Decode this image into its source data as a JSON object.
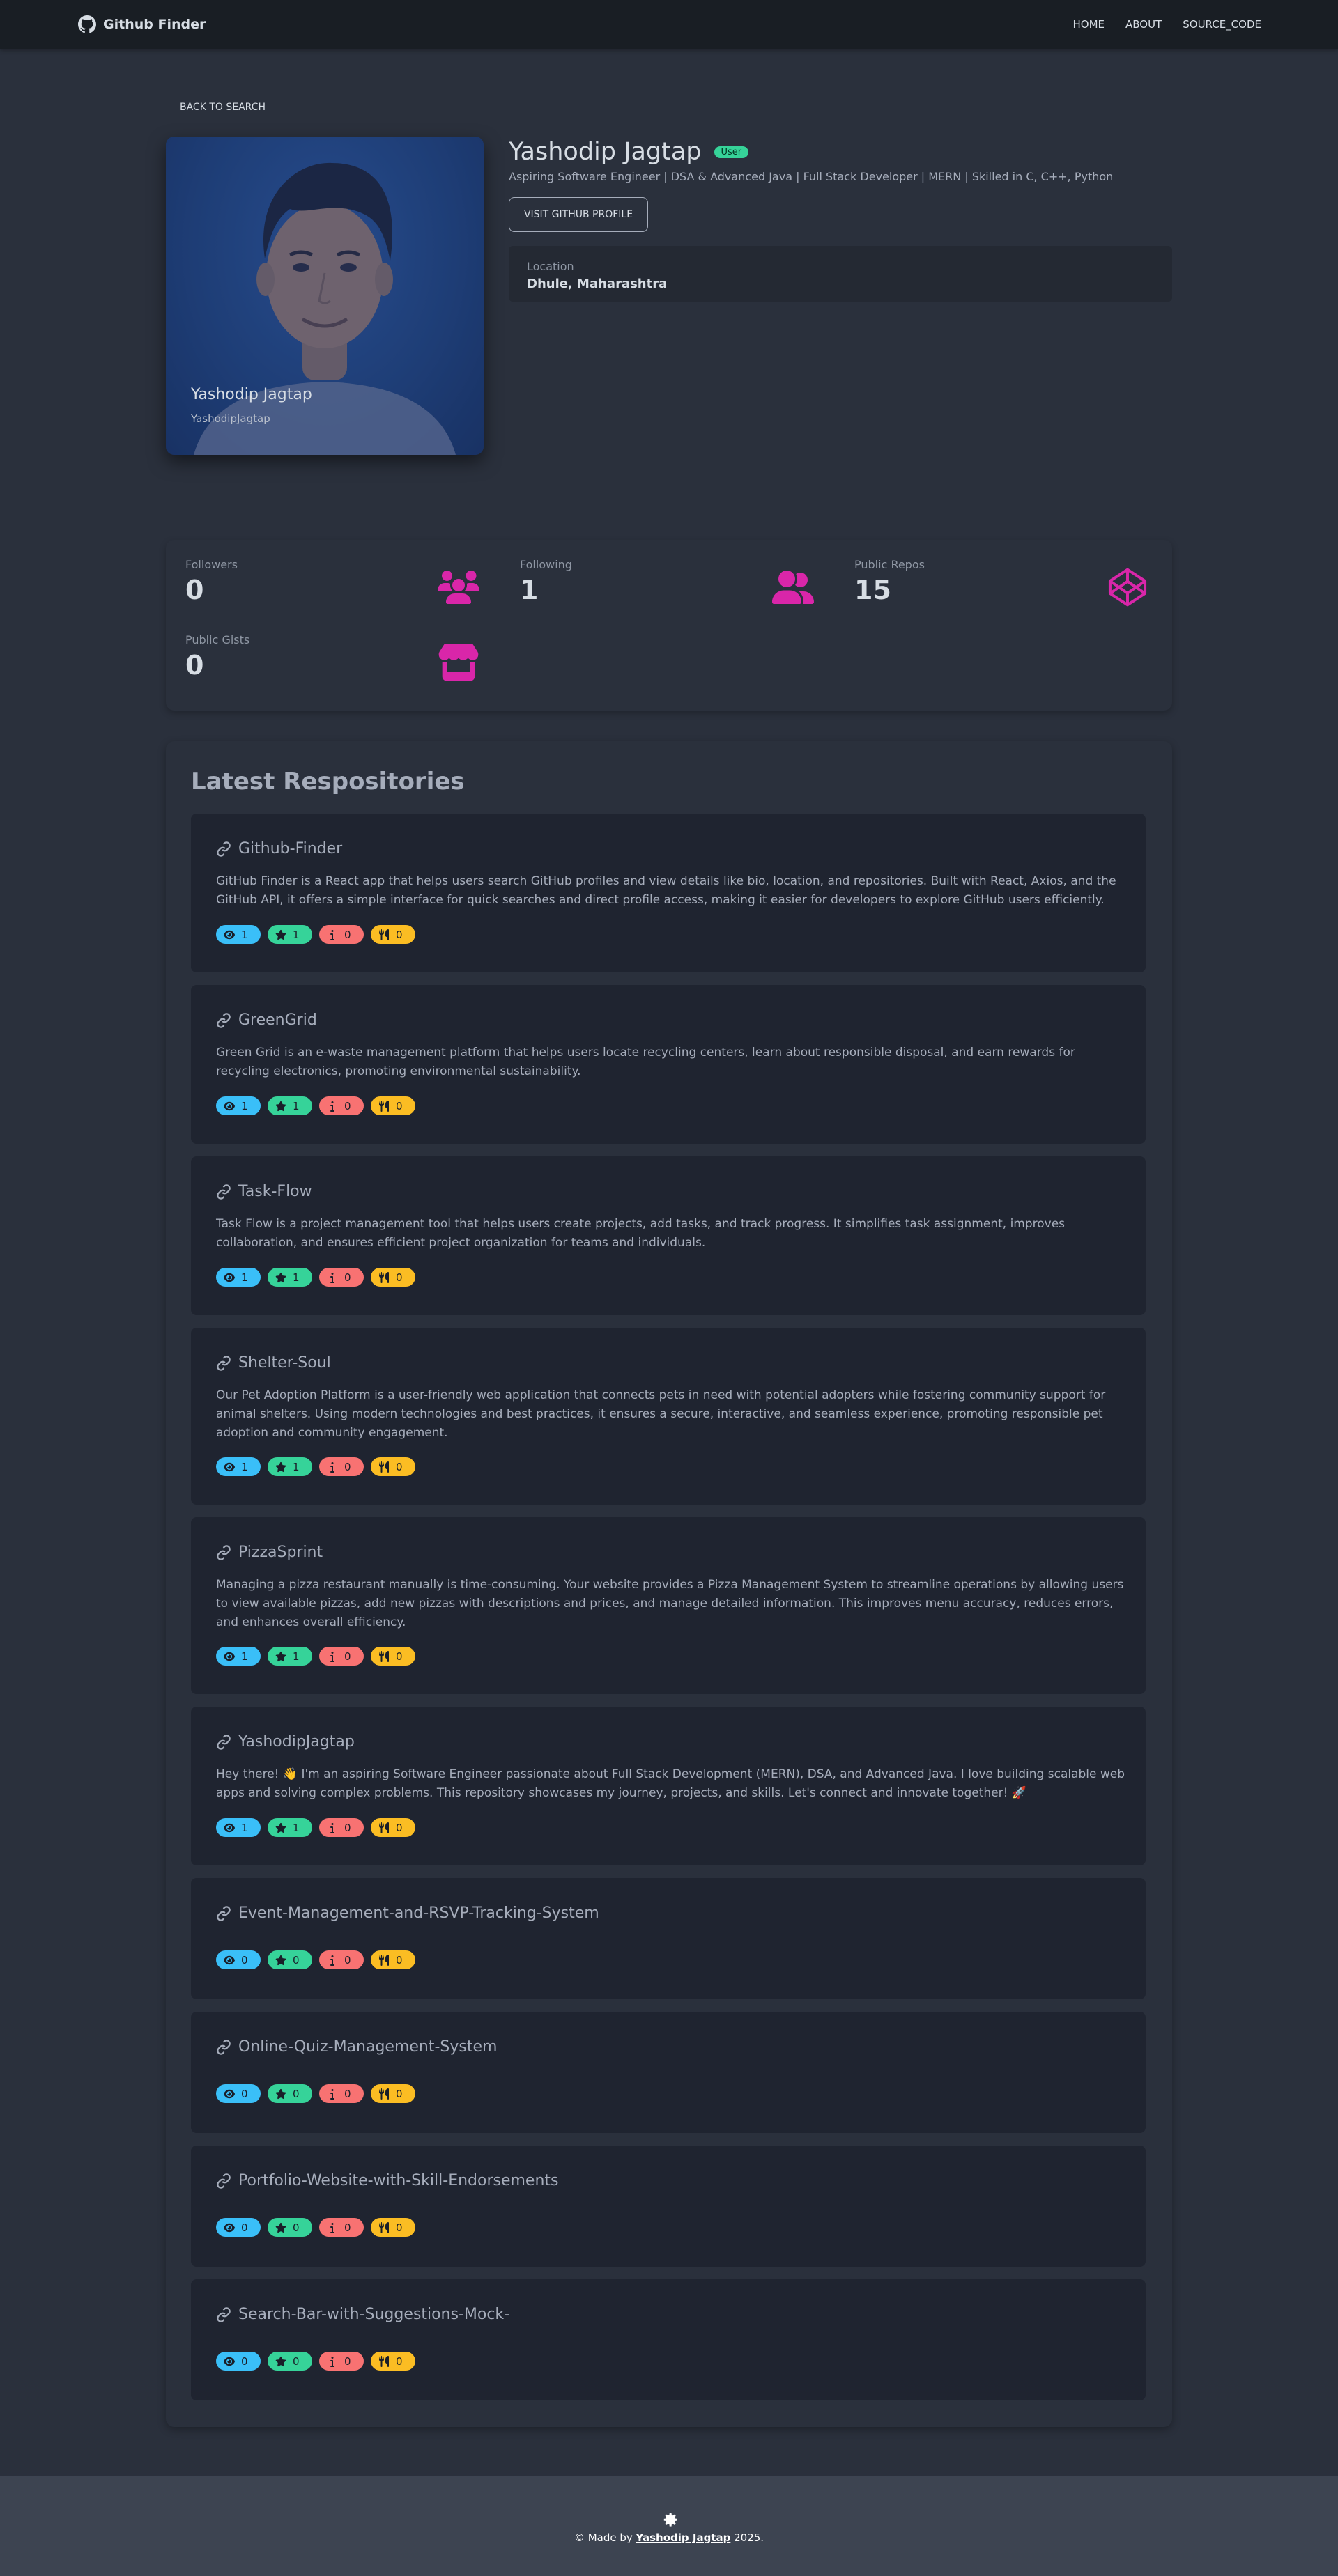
{
  "navbar": {
    "brand": "Github Finder",
    "links": [
      "HOME",
      "ABOUT",
      "SOURCE_CODE"
    ]
  },
  "back_label": "BACK TO SEARCH",
  "profile": {
    "avatar_name": "Yashodip Jagtap",
    "avatar_login": "YashodipJagtap",
    "name": "Yashodip Jagtap",
    "type_badge": "User",
    "bio": "Aspiring Software Engineer | DSA & Advanced Java | Full Stack Developer | MERN | Skilled in C, C++, Python",
    "visit_label": "VISIT GITHUB PROFILE",
    "location_label": "Location",
    "location_value": "Dhule, Maharashtra"
  },
  "stats": [
    {
      "title": "Followers",
      "value": "0",
      "icon": "users-group-icon"
    },
    {
      "title": "Following",
      "value": "1",
      "icon": "user-friends-icon"
    },
    {
      "title": "Public Repos",
      "value": "15",
      "icon": "codepen-icon"
    },
    {
      "title": "Public Gists",
      "value": "0",
      "icon": "store-icon"
    }
  ],
  "repos_title": "Latest Respositories",
  "repos": [
    {
      "name": "Github-Finder",
      "desc": "GitHub Finder is a React app that helps users search GitHub profiles and view details like bio, location, and repositories. Built with React, Axios, and the GitHub API, it offers a simple interface for quick searches and direct profile access, making it easier for developers to explore GitHub users efficiently.",
      "watchers": "1",
      "stars": "1",
      "issues": "0",
      "forks": "0"
    },
    {
      "name": "GreenGrid",
      "desc": "Green Grid is an e-waste management platform that helps users locate recycling centers, learn about responsible disposal, and earn rewards for recycling electronics, promoting environmental sustainability.",
      "watchers": "1",
      "stars": "1",
      "issues": "0",
      "forks": "0"
    },
    {
      "name": "Task-Flow",
      "desc": "Task Flow is a project management tool that helps users create projects, add tasks, and track progress. It simplifies task assignment, improves collaboration, and ensures efficient project organization for teams and individuals.",
      "watchers": "1",
      "stars": "1",
      "issues": "0",
      "forks": "0"
    },
    {
      "name": "Shelter-Soul",
      "desc": "Our Pet Adoption Platform is a user-friendly web application that connects pets in need with potential adopters while fostering community support for animal shelters. Using modern technologies and best practices, it ensures a secure, interactive, and seamless experience, promoting responsible pet adoption and community engagement.",
      "watchers": "1",
      "stars": "1",
      "issues": "0",
      "forks": "0"
    },
    {
      "name": "PizzaSprint",
      "desc": "Managing a pizza restaurant manually is time-consuming. Your website provides a Pizza Management System to streamline operations by allowing users to view available pizzas, add new pizzas with descriptions and prices, and manage detailed information. This improves menu accuracy, reduces errors, and enhances overall efficiency.",
      "watchers": "1",
      "stars": "1",
      "issues": "0",
      "forks": "0"
    },
    {
      "name": "YashodipJagtap",
      "desc": "Hey there! 👋 I'm an aspiring Software Engineer passionate about Full Stack Development (MERN), DSA, and Advanced Java. I love building scalable web apps and solving complex problems. This repository showcases my journey, projects, and skills. Let's connect and innovate together! 🚀",
      "watchers": "1",
      "stars": "1",
      "issues": "0",
      "forks": "0"
    },
    {
      "name": "Event-Management-and-RSVP-Tracking-System",
      "desc": "",
      "watchers": "0",
      "stars": "0",
      "issues": "0",
      "forks": "0"
    },
    {
      "name": "Online-Quiz-Management-System",
      "desc": "",
      "watchers": "0",
      "stars": "0",
      "issues": "0",
      "forks": "0"
    },
    {
      "name": "Portfolio-Website-with-Skill-Endorsements",
      "desc": "",
      "watchers": "0",
      "stars": "0",
      "issues": "0",
      "forks": "0"
    },
    {
      "name": "Search-Bar-with-Suggestions-Mock-",
      "desc": "",
      "watchers": "0",
      "stars": "0",
      "issues": "0",
      "forks": "0"
    }
  ],
  "footer": {
    "prefix": "© Made by ",
    "author": "Yashodip Jagtap",
    "suffix": " 2025.",
    "icon": "gear-icon"
  }
}
